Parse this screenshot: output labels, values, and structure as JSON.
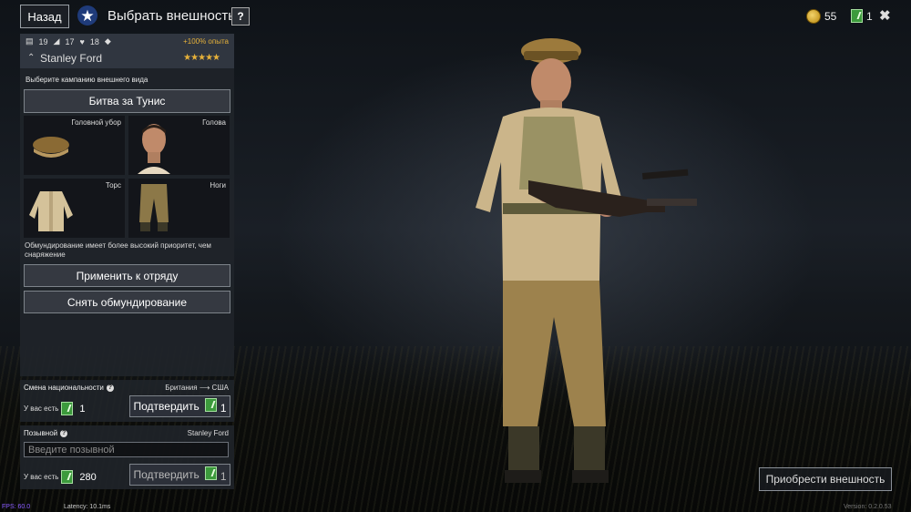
{
  "header": {
    "back_label": "Назад",
    "title": "Выбрать внешность",
    "help_label": "?",
    "gold": "55",
    "tickets": "1",
    "close_label": "✖"
  },
  "soldier": {
    "stat1": "19",
    "stat2": "17",
    "stat3": "18",
    "xp_bonus": "+100% опыта",
    "name": "Stanley Ford",
    "stars": "★★★★★"
  },
  "appearance": {
    "campaign_prompt": "Выберите кампанию внешнего вида",
    "campaign": "Битва за Тунис",
    "slots": {
      "headgear": "Головной убор",
      "head": "Голова",
      "torso": "Торс",
      "legs": "Ноги"
    },
    "priority_note": "Обмундирование имеет более высокий приоритет, чем снаряжение",
    "apply_label": "Применить к отряду",
    "remove_label": "Снять обмундирование"
  },
  "nationality": {
    "title": "Смена национальности",
    "from": "Британия",
    "arrow": "⟶",
    "to": "США",
    "have_label": "У вас есть",
    "have_value": "1",
    "confirm_label": "Подтвердить",
    "cost": "1"
  },
  "callsign": {
    "title": "Позывной",
    "current": "Stanley Ford",
    "placeholder": "Введите позывной",
    "have_label": "У вас есть",
    "have_value": "280",
    "confirm_label": "Подтвердить",
    "cost": "1"
  },
  "buy_label": "Приобрести внешность",
  "debug": {
    "fps": "FPS: 60.0",
    "latency": "Latency: 10.1ms",
    "version": "Version: 0.2.0.53"
  }
}
